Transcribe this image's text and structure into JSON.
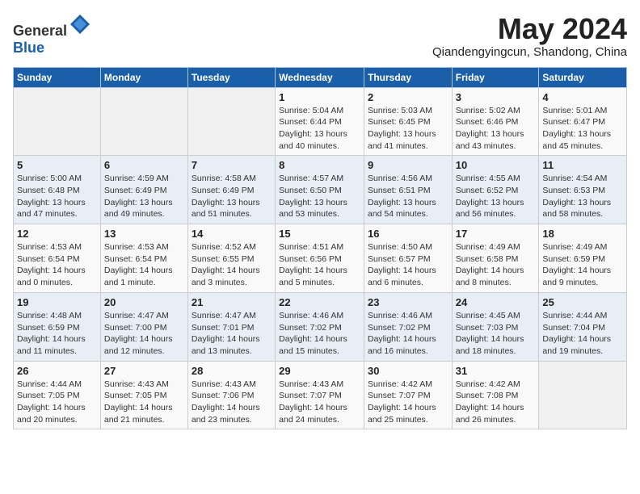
{
  "header": {
    "logo_general": "General",
    "logo_blue": "Blue",
    "month_year": "May 2024",
    "location": "Qiandengyingcun, Shandong, China"
  },
  "weekdays": [
    "Sunday",
    "Monday",
    "Tuesday",
    "Wednesday",
    "Thursday",
    "Friday",
    "Saturday"
  ],
  "weeks": [
    [
      {
        "day": "",
        "info": ""
      },
      {
        "day": "",
        "info": ""
      },
      {
        "day": "",
        "info": ""
      },
      {
        "day": "1",
        "info": "Sunrise: 5:04 AM\nSunset: 6:44 PM\nDaylight: 13 hours\nand 40 minutes."
      },
      {
        "day": "2",
        "info": "Sunrise: 5:03 AM\nSunset: 6:45 PM\nDaylight: 13 hours\nand 41 minutes."
      },
      {
        "day": "3",
        "info": "Sunrise: 5:02 AM\nSunset: 6:46 PM\nDaylight: 13 hours\nand 43 minutes."
      },
      {
        "day": "4",
        "info": "Sunrise: 5:01 AM\nSunset: 6:47 PM\nDaylight: 13 hours\nand 45 minutes."
      }
    ],
    [
      {
        "day": "5",
        "info": "Sunrise: 5:00 AM\nSunset: 6:48 PM\nDaylight: 13 hours\nand 47 minutes."
      },
      {
        "day": "6",
        "info": "Sunrise: 4:59 AM\nSunset: 6:49 PM\nDaylight: 13 hours\nand 49 minutes."
      },
      {
        "day": "7",
        "info": "Sunrise: 4:58 AM\nSunset: 6:49 PM\nDaylight: 13 hours\nand 51 minutes."
      },
      {
        "day": "8",
        "info": "Sunrise: 4:57 AM\nSunset: 6:50 PM\nDaylight: 13 hours\nand 53 minutes."
      },
      {
        "day": "9",
        "info": "Sunrise: 4:56 AM\nSunset: 6:51 PM\nDaylight: 13 hours\nand 54 minutes."
      },
      {
        "day": "10",
        "info": "Sunrise: 4:55 AM\nSunset: 6:52 PM\nDaylight: 13 hours\nand 56 minutes."
      },
      {
        "day": "11",
        "info": "Sunrise: 4:54 AM\nSunset: 6:53 PM\nDaylight: 13 hours\nand 58 minutes."
      }
    ],
    [
      {
        "day": "12",
        "info": "Sunrise: 4:53 AM\nSunset: 6:54 PM\nDaylight: 14 hours\nand 0 minutes."
      },
      {
        "day": "13",
        "info": "Sunrise: 4:53 AM\nSunset: 6:54 PM\nDaylight: 14 hours\nand 1 minute."
      },
      {
        "day": "14",
        "info": "Sunrise: 4:52 AM\nSunset: 6:55 PM\nDaylight: 14 hours\nand 3 minutes."
      },
      {
        "day": "15",
        "info": "Sunrise: 4:51 AM\nSunset: 6:56 PM\nDaylight: 14 hours\nand 5 minutes."
      },
      {
        "day": "16",
        "info": "Sunrise: 4:50 AM\nSunset: 6:57 PM\nDaylight: 14 hours\nand 6 minutes."
      },
      {
        "day": "17",
        "info": "Sunrise: 4:49 AM\nSunset: 6:58 PM\nDaylight: 14 hours\nand 8 minutes."
      },
      {
        "day": "18",
        "info": "Sunrise: 4:49 AM\nSunset: 6:59 PM\nDaylight: 14 hours\nand 9 minutes."
      }
    ],
    [
      {
        "day": "19",
        "info": "Sunrise: 4:48 AM\nSunset: 6:59 PM\nDaylight: 14 hours\nand 11 minutes."
      },
      {
        "day": "20",
        "info": "Sunrise: 4:47 AM\nSunset: 7:00 PM\nDaylight: 14 hours\nand 12 minutes."
      },
      {
        "day": "21",
        "info": "Sunrise: 4:47 AM\nSunset: 7:01 PM\nDaylight: 14 hours\nand 13 minutes."
      },
      {
        "day": "22",
        "info": "Sunrise: 4:46 AM\nSunset: 7:02 PM\nDaylight: 14 hours\nand 15 minutes."
      },
      {
        "day": "23",
        "info": "Sunrise: 4:46 AM\nSunset: 7:02 PM\nDaylight: 14 hours\nand 16 minutes."
      },
      {
        "day": "24",
        "info": "Sunrise: 4:45 AM\nSunset: 7:03 PM\nDaylight: 14 hours\nand 18 minutes."
      },
      {
        "day": "25",
        "info": "Sunrise: 4:44 AM\nSunset: 7:04 PM\nDaylight: 14 hours\nand 19 minutes."
      }
    ],
    [
      {
        "day": "26",
        "info": "Sunrise: 4:44 AM\nSunset: 7:05 PM\nDaylight: 14 hours\nand 20 minutes."
      },
      {
        "day": "27",
        "info": "Sunrise: 4:43 AM\nSunset: 7:05 PM\nDaylight: 14 hours\nand 21 minutes."
      },
      {
        "day": "28",
        "info": "Sunrise: 4:43 AM\nSunset: 7:06 PM\nDaylight: 14 hours\nand 23 minutes."
      },
      {
        "day": "29",
        "info": "Sunrise: 4:43 AM\nSunset: 7:07 PM\nDaylight: 14 hours\nand 24 minutes."
      },
      {
        "day": "30",
        "info": "Sunrise: 4:42 AM\nSunset: 7:07 PM\nDaylight: 14 hours\nand 25 minutes."
      },
      {
        "day": "31",
        "info": "Sunrise: 4:42 AM\nSunset: 7:08 PM\nDaylight: 14 hours\nand 26 minutes."
      },
      {
        "day": "",
        "info": ""
      }
    ]
  ]
}
